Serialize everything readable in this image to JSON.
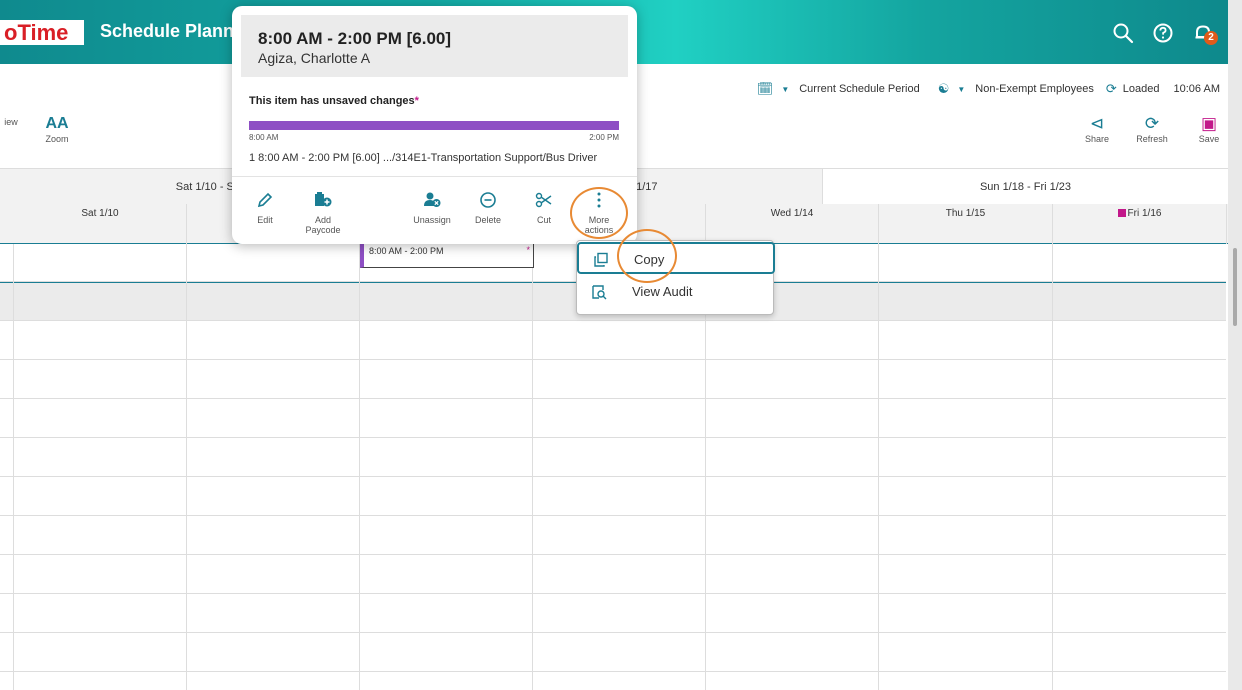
{
  "header": {
    "logo": "oTime",
    "title": "Schedule Planner",
    "icons": [
      "search-icon",
      "help-icon",
      "notifications-icon"
    ],
    "notification_count": "2"
  },
  "toolbar": {
    "period_label": "Current Schedule Period",
    "group_label": "Non-Exempt Employees",
    "status_label": "Loaded",
    "time": "10:06 AM",
    "view_label": "iew",
    "zoom_label": "Zoom",
    "share_label": "Share",
    "refresh_label": "Refresh",
    "save_label": "Save"
  },
  "grid": {
    "periods": [
      "Sat 1/10 - Sa",
      "t 1/17",
      "Sun 1/18 - Fri 1/23"
    ],
    "days": [
      "Sat 1/10",
      "Wed 1/14",
      "Thu 1/15",
      "Fri 1/16"
    ],
    "shift_label": "8:00 AM - 2:00 PM"
  },
  "popover": {
    "time": "8:00 AM - 2:00 PM [6.00]",
    "employee": "Agiza, Charlotte A",
    "unsaved": "This item has unsaved changes",
    "unsaved_marker": "*",
    "bar_start": "8:00 AM",
    "bar_end": "2:00 PM",
    "segment": "1  8:00 AM - 2:00 PM [6.00]   .../314E1-Transportation Support/Bus Driver",
    "actions": {
      "edit": "Edit",
      "add_paycode_1": "Add",
      "add_paycode_2": "Paycode",
      "unassign": "Unassign",
      "delete": "Delete",
      "cut": "Cut",
      "more_1": "More",
      "more_2": "actions"
    }
  },
  "menu": {
    "copy": "Copy",
    "view_audit": "View Audit"
  },
  "colors": {
    "accent": "#1a7d93",
    "shift": "#8e4fc4",
    "highlight": "#e88a34",
    "alert": "#c2188a"
  }
}
